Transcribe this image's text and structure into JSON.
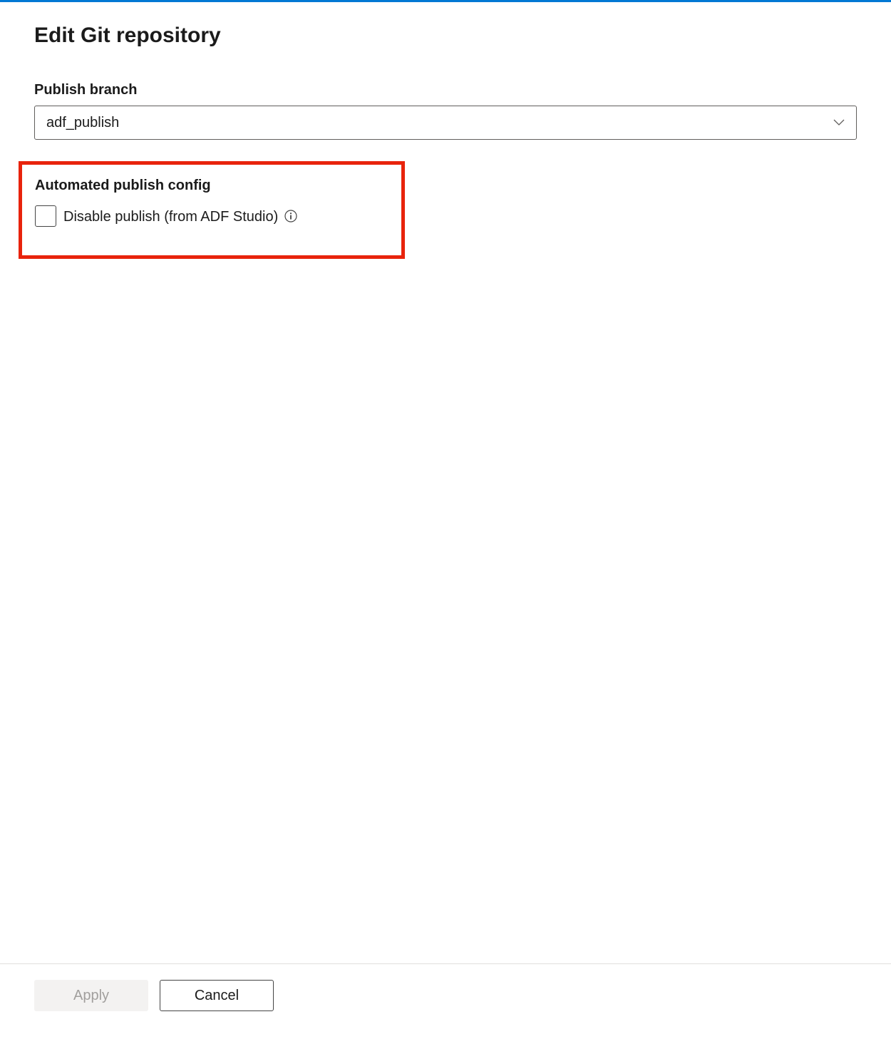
{
  "title": "Edit Git repository",
  "publish_branch": {
    "label": "Publish branch",
    "value": "adf_publish"
  },
  "automated_publish": {
    "label": "Automated publish config",
    "checkbox_label": "Disable publish (from ADF Studio)"
  },
  "footer": {
    "apply_label": "Apply",
    "cancel_label": "Cancel"
  }
}
